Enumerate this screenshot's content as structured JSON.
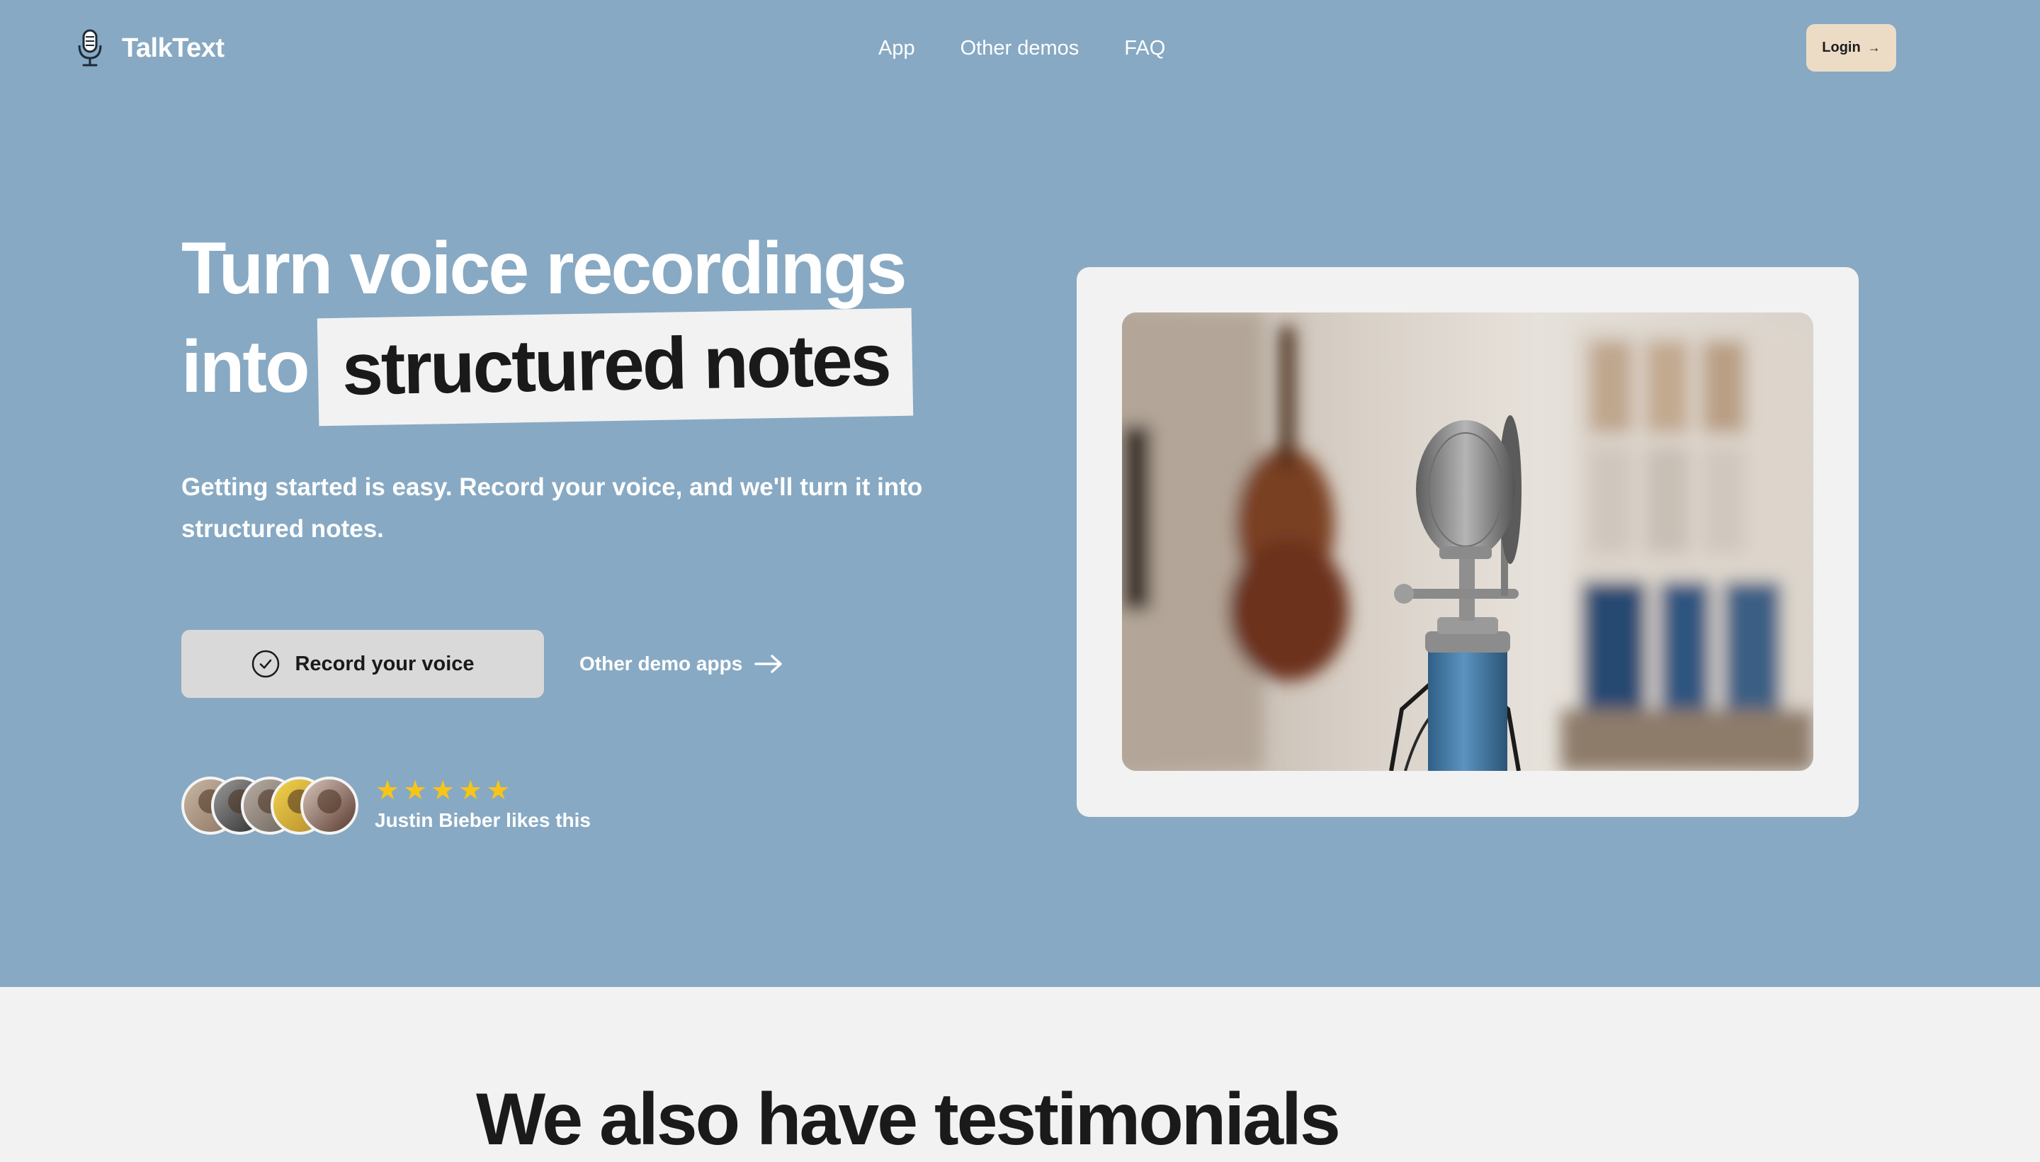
{
  "brand": {
    "name": "TalkText",
    "icon": "microphone-icon"
  },
  "nav": {
    "items": [
      "App",
      "Other demos",
      "FAQ"
    ]
  },
  "login": {
    "label": "Login",
    "icon": "arrow-right-icon"
  },
  "hero": {
    "headline_line1": "Turn voice recordings",
    "headline_into": "into",
    "headline_highlight": "structured notes",
    "subtext": "Getting started is easy. Record your voice, and we'll turn it into structured notes.",
    "primary_cta": {
      "label": "Record your voice",
      "icon": "check-circle-icon"
    },
    "secondary_cta": {
      "label": "Other demo apps",
      "icon": "arrow-right-icon"
    },
    "social_proof": {
      "stars": 5,
      "caption": "Justin Bieber likes this",
      "avatar_count": 5
    },
    "image": {
      "subject": "studio microphone photo"
    }
  },
  "testimonials": {
    "title": "We also have testimonials"
  },
  "colors": {
    "hero_bg": "#87a9c3",
    "page_bg": "#f2f2f2",
    "login_bg": "#ecdcc6",
    "button_bg": "#d9d9d9",
    "star": "#f6c518",
    "text_dark": "#1a1a1a",
    "text_light": "#ffffff"
  }
}
